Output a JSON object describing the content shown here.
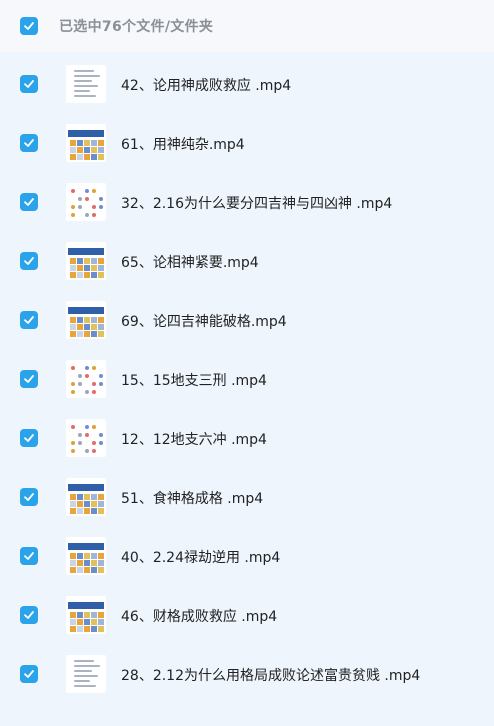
{
  "header": {
    "selection_text": "已选中76个文件/文件夹"
  },
  "files": [
    {
      "name": "42、论用神成败救应 .mp4",
      "thumb": "doc-thumb"
    },
    {
      "name": "61、用神纯杂.mp4",
      "thumb": "table-thumb"
    },
    {
      "name": "32、2.16为什么要分四吉神与四凶神 .mp4",
      "thumb": "dots-thumb"
    },
    {
      "name": "65、论相神紧要.mp4",
      "thumb": "table-thumb"
    },
    {
      "name": "69、论四吉神能破格.mp4",
      "thumb": "table-thumb"
    },
    {
      "name": "15、15地支三刑 .mp4",
      "thumb": "dots-thumb"
    },
    {
      "name": "12、12地支六冲 .mp4",
      "thumb": "dots-thumb"
    },
    {
      "name": "51、食神格成格 .mp4",
      "thumb": "table-thumb"
    },
    {
      "name": "40、2.24禄劫逆用 .mp4",
      "thumb": "table-thumb"
    },
    {
      "name": "46、财格成败救应 .mp4",
      "thumb": "table-thumb"
    },
    {
      "name": "28、2.12为什么用格局成败论述富贵贫贱 .mp4",
      "thumb": "doc-thumb"
    }
  ],
  "colors": {
    "checkbox": "#2aa3ea",
    "background": "#eef5fd",
    "header_bg": "#f6f8fb"
  }
}
